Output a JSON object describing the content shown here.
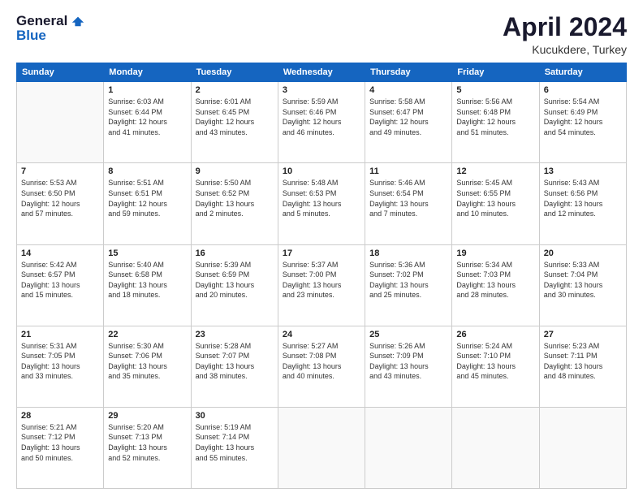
{
  "logo": {
    "general": "General",
    "blue": "Blue"
  },
  "title": "April 2024",
  "location": "Kucukdere, Turkey",
  "days_of_week": [
    "Sunday",
    "Monday",
    "Tuesday",
    "Wednesday",
    "Thursday",
    "Friday",
    "Saturday"
  ],
  "weeks": [
    [
      {
        "day": "",
        "info": ""
      },
      {
        "day": "1",
        "info": "Sunrise: 6:03 AM\nSunset: 6:44 PM\nDaylight: 12 hours\nand 41 minutes."
      },
      {
        "day": "2",
        "info": "Sunrise: 6:01 AM\nSunset: 6:45 PM\nDaylight: 12 hours\nand 43 minutes."
      },
      {
        "day": "3",
        "info": "Sunrise: 5:59 AM\nSunset: 6:46 PM\nDaylight: 12 hours\nand 46 minutes."
      },
      {
        "day": "4",
        "info": "Sunrise: 5:58 AM\nSunset: 6:47 PM\nDaylight: 12 hours\nand 49 minutes."
      },
      {
        "day": "5",
        "info": "Sunrise: 5:56 AM\nSunset: 6:48 PM\nDaylight: 12 hours\nand 51 minutes."
      },
      {
        "day": "6",
        "info": "Sunrise: 5:54 AM\nSunset: 6:49 PM\nDaylight: 12 hours\nand 54 minutes."
      }
    ],
    [
      {
        "day": "7",
        "info": "Sunrise: 5:53 AM\nSunset: 6:50 PM\nDaylight: 12 hours\nand 57 minutes."
      },
      {
        "day": "8",
        "info": "Sunrise: 5:51 AM\nSunset: 6:51 PM\nDaylight: 12 hours\nand 59 minutes."
      },
      {
        "day": "9",
        "info": "Sunrise: 5:50 AM\nSunset: 6:52 PM\nDaylight: 13 hours\nand 2 minutes."
      },
      {
        "day": "10",
        "info": "Sunrise: 5:48 AM\nSunset: 6:53 PM\nDaylight: 13 hours\nand 5 minutes."
      },
      {
        "day": "11",
        "info": "Sunrise: 5:46 AM\nSunset: 6:54 PM\nDaylight: 13 hours\nand 7 minutes."
      },
      {
        "day": "12",
        "info": "Sunrise: 5:45 AM\nSunset: 6:55 PM\nDaylight: 13 hours\nand 10 minutes."
      },
      {
        "day": "13",
        "info": "Sunrise: 5:43 AM\nSunset: 6:56 PM\nDaylight: 13 hours\nand 12 minutes."
      }
    ],
    [
      {
        "day": "14",
        "info": "Sunrise: 5:42 AM\nSunset: 6:57 PM\nDaylight: 13 hours\nand 15 minutes."
      },
      {
        "day": "15",
        "info": "Sunrise: 5:40 AM\nSunset: 6:58 PM\nDaylight: 13 hours\nand 18 minutes."
      },
      {
        "day": "16",
        "info": "Sunrise: 5:39 AM\nSunset: 6:59 PM\nDaylight: 13 hours\nand 20 minutes."
      },
      {
        "day": "17",
        "info": "Sunrise: 5:37 AM\nSunset: 7:00 PM\nDaylight: 13 hours\nand 23 minutes."
      },
      {
        "day": "18",
        "info": "Sunrise: 5:36 AM\nSunset: 7:02 PM\nDaylight: 13 hours\nand 25 minutes."
      },
      {
        "day": "19",
        "info": "Sunrise: 5:34 AM\nSunset: 7:03 PM\nDaylight: 13 hours\nand 28 minutes."
      },
      {
        "day": "20",
        "info": "Sunrise: 5:33 AM\nSunset: 7:04 PM\nDaylight: 13 hours\nand 30 minutes."
      }
    ],
    [
      {
        "day": "21",
        "info": "Sunrise: 5:31 AM\nSunset: 7:05 PM\nDaylight: 13 hours\nand 33 minutes."
      },
      {
        "day": "22",
        "info": "Sunrise: 5:30 AM\nSunset: 7:06 PM\nDaylight: 13 hours\nand 35 minutes."
      },
      {
        "day": "23",
        "info": "Sunrise: 5:28 AM\nSunset: 7:07 PM\nDaylight: 13 hours\nand 38 minutes."
      },
      {
        "day": "24",
        "info": "Sunrise: 5:27 AM\nSunset: 7:08 PM\nDaylight: 13 hours\nand 40 minutes."
      },
      {
        "day": "25",
        "info": "Sunrise: 5:26 AM\nSunset: 7:09 PM\nDaylight: 13 hours\nand 43 minutes."
      },
      {
        "day": "26",
        "info": "Sunrise: 5:24 AM\nSunset: 7:10 PM\nDaylight: 13 hours\nand 45 minutes."
      },
      {
        "day": "27",
        "info": "Sunrise: 5:23 AM\nSunset: 7:11 PM\nDaylight: 13 hours\nand 48 minutes."
      }
    ],
    [
      {
        "day": "28",
        "info": "Sunrise: 5:21 AM\nSunset: 7:12 PM\nDaylight: 13 hours\nand 50 minutes."
      },
      {
        "day": "29",
        "info": "Sunrise: 5:20 AM\nSunset: 7:13 PM\nDaylight: 13 hours\nand 52 minutes."
      },
      {
        "day": "30",
        "info": "Sunrise: 5:19 AM\nSunset: 7:14 PM\nDaylight: 13 hours\nand 55 minutes."
      },
      {
        "day": "",
        "info": ""
      },
      {
        "day": "",
        "info": ""
      },
      {
        "day": "",
        "info": ""
      },
      {
        "day": "",
        "info": ""
      }
    ]
  ]
}
